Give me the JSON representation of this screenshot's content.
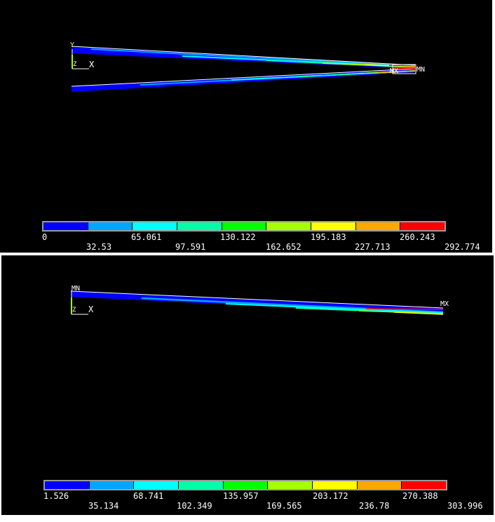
{
  "plots": [
    {
      "labels": {
        "y": "Y",
        "x": "X",
        "z": "Z",
        "min": "MN",
        "max": "MX"
      },
      "legend": {
        "ticks_lower": [
          "0",
          "65.061",
          "130.122",
          "195.183",
          "260.243"
        ],
        "ticks_upper": [
          "32.53",
          "97.591",
          "162.652",
          "227.713",
          "292.774"
        ]
      }
    },
    {
      "labels": {
        "x": "X",
        "z": "Z",
        "min": "MN",
        "max": "MX"
      },
      "legend": {
        "ticks_lower": [
          "1.526",
          "68.741",
          "135.957",
          "203.172",
          "270.388"
        ],
        "ticks_upper": [
          "35.134",
          "102.349",
          "169.565",
          "236.78",
          "303.996"
        ]
      }
    }
  ],
  "contour_colors": [
    "#0000ff",
    "#00a6ff",
    "#00ffff",
    "#00ffa6",
    "#00ff00",
    "#a6ff00",
    "#ffff00",
    "#ffa600",
    "#ff0000"
  ]
}
